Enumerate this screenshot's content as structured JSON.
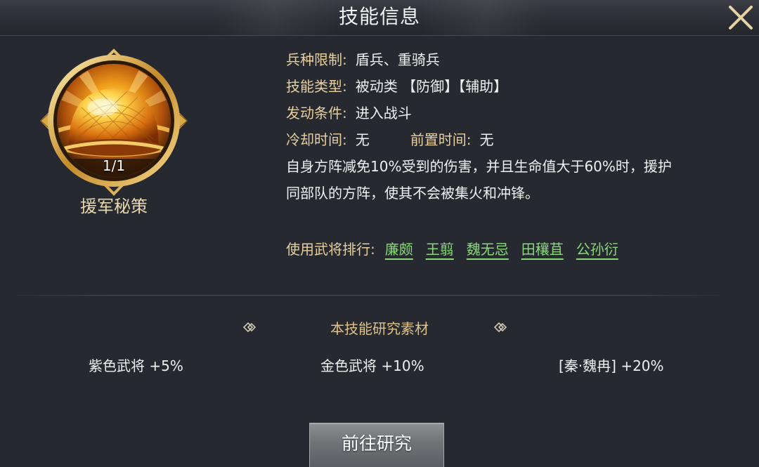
{
  "header": {
    "title": "技能信息",
    "close_icon": "close-icon"
  },
  "skill": {
    "icon": "golden-shield-dome-icon",
    "level": "1/1",
    "name": "援军秘策"
  },
  "info": {
    "troop_label": "兵种限制:",
    "troop_value": "盾兵、重骑兵",
    "type_label": "技能类型:",
    "type_value": "被动类 【防御】【辅助】",
    "trigger_label": "发动条件:",
    "trigger_value": "进入战斗",
    "cooldown_label": "冷却时间:",
    "cooldown_value": "无",
    "precast_label": "前置时间:",
    "precast_value": "无",
    "description_line1": "自身方阵减免10%受到的伤害，并且生命值大于60%时，援护",
    "description_line2": "同部队的方阵，使其不会被集火和冲锋。"
  },
  "ranking": {
    "label": "使用武将排行:",
    "generals": [
      "廉颇",
      "王翦",
      "魏无忌",
      "田穰苴",
      "公孙衍"
    ]
  },
  "materials": {
    "title": "本技能研究素材",
    "items": [
      "紫色武将 +5%",
      "金色武将 +10%",
      "[秦·魏冉] +20%"
    ]
  },
  "research_button": "前往研究",
  "colors": {
    "background": "#262a30",
    "label_gold": "#e8cf9e",
    "link_green": "#89d97a",
    "materials_title": "#e0c189"
  }
}
